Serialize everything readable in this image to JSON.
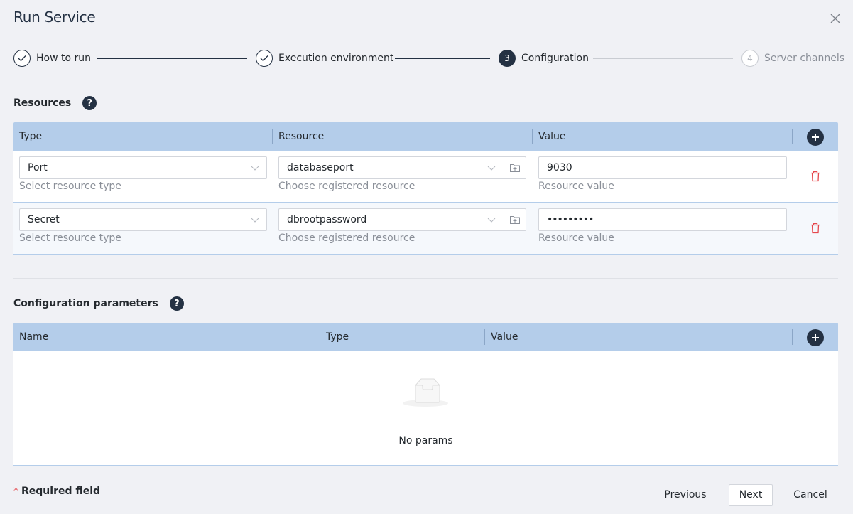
{
  "dialog": {
    "title": "Run Service",
    "close_icon": "close-icon"
  },
  "stepper": {
    "steps": [
      {
        "label": "How to run",
        "state": "done",
        "marker": "check-icon"
      },
      {
        "label": "Execution environment",
        "state": "done",
        "marker": "check-icon"
      },
      {
        "label": "Configuration",
        "state": "active",
        "number": "3"
      },
      {
        "label": "Server channels",
        "state": "todo",
        "number": "4"
      }
    ]
  },
  "resources": {
    "title": "Resources",
    "help_label": "?",
    "columns": [
      "Type",
      "Resource",
      "Value"
    ],
    "add_icon": "plus-icon",
    "rows": [
      {
        "type": "Port",
        "type_hint": "Select resource type",
        "resource": "databaseport",
        "resource_hint": "Choose registered resource",
        "value": "9030",
        "value_hint": "Resource value"
      },
      {
        "type": "Secret",
        "type_hint": "Select resource type",
        "resource": "dbrootpassword",
        "resource_hint": "Choose registered resource",
        "value": "•••••••••",
        "value_hint": "Resource value"
      }
    ]
  },
  "config_params": {
    "title": "Configuration parameters",
    "help_label": "?",
    "columns": [
      "Name",
      "Type",
      "Value"
    ],
    "add_icon": "plus-icon",
    "empty_text": "No params"
  },
  "footer": {
    "required_star": "*",
    "required_label": "Required field",
    "previous_label": "Previous",
    "next_label": "Next",
    "cancel_label": "Cancel"
  },
  "colors": {
    "accent": "#243143",
    "header_bg": "#b4cdea",
    "danger": "#e5484d",
    "page_bg": "#f0f1f5"
  }
}
